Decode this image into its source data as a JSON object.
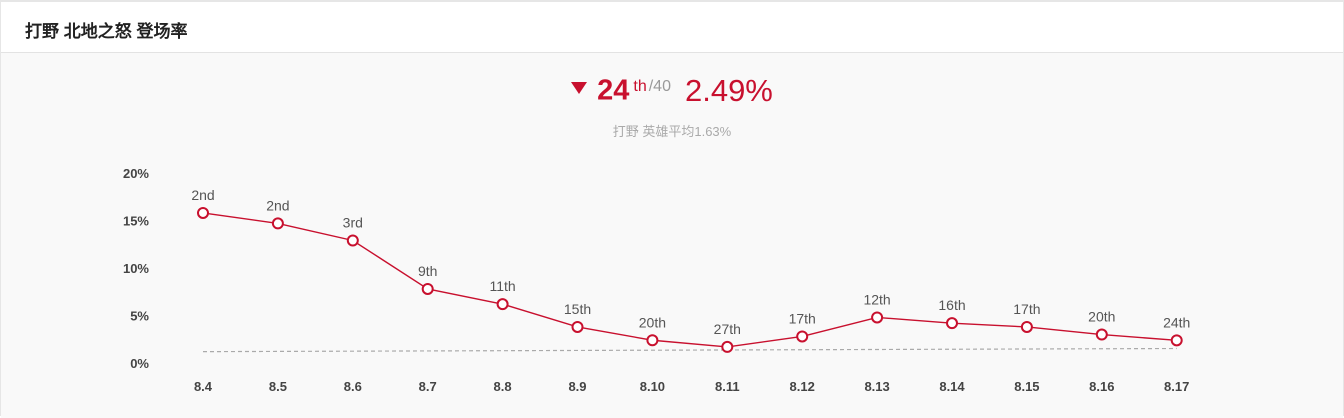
{
  "header": {
    "title": "打野 北地之怒 登场率"
  },
  "summary": {
    "trend_icon": "trend-down-icon",
    "rank": "24",
    "rank_suffix": "th",
    "rank_total": "/40",
    "rate": "2.49%",
    "avg_text": "打野 英雄平均1.63%"
  },
  "colors": {
    "accent": "#c8102e",
    "avg_line": "#aaaaaa",
    "background": "#f9f9f9"
  },
  "chart_data": {
    "type": "line",
    "title": "打野 北地之怒 登场率",
    "categories": [
      "8.4",
      "8.5",
      "8.6",
      "8.7",
      "8.8",
      "8.9",
      "8.10",
      "8.11",
      "8.12",
      "8.13",
      "8.14",
      "8.15",
      "8.16",
      "8.17"
    ],
    "series": [
      {
        "values": [
          15.9,
          14.8,
          13.0,
          7.9,
          6.3,
          3.9,
          2.5,
          1.8,
          2.9,
          4.9,
          4.3,
          3.9,
          3.1,
          2.49
        ]
      }
    ],
    "rank_labels": [
      "2nd",
      "2nd",
      "3rd",
      "9th",
      "11th",
      "15th",
      "20th",
      "27th",
      "17th",
      "12th",
      "16th",
      "17th",
      "20th",
      "24th"
    ],
    "average": {
      "values": [
        1.3,
        1.63
      ]
    },
    "yticks": [
      "20%",
      "15%",
      "10%",
      "5%",
      "0%"
    ],
    "ylim": [
      0,
      20
    ],
    "xlabel": "",
    "ylabel": "",
    "grid": false,
    "legend": "none"
  }
}
